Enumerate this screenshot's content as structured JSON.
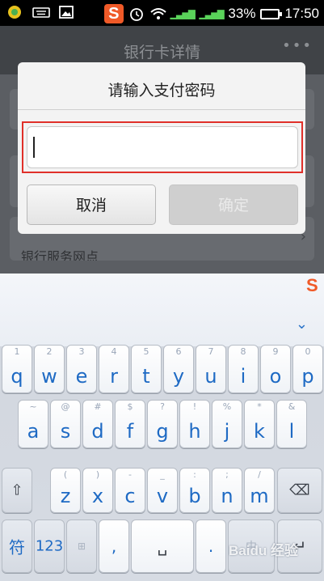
{
  "status_bar": {
    "battery": "33%",
    "time": "17:50",
    "left_icons": [
      "app-notification-icon",
      "keyboard-icon",
      "image-icon"
    ],
    "right_icons": [
      "sogou-input-icon",
      "alarm-icon",
      "wifi-icon",
      "signal-icon",
      "signal-icon",
      "battery-icon"
    ]
  },
  "background_app": {
    "title": "银行卡详情",
    "more": "•••",
    "row_label": "银行服务网点"
  },
  "dialog": {
    "title": "请输入支付密码",
    "input_value": "",
    "cancel_label": "取消",
    "confirm_label": "确定",
    "highlight_color": "#e0302a"
  },
  "keyboard": {
    "collapse_icon": "chevron-down-icon",
    "row1": [
      {
        "main": "q",
        "sub": "1"
      },
      {
        "main": "w",
        "sub": "2"
      },
      {
        "main": "e",
        "sub": "3"
      },
      {
        "main": "r",
        "sub": "4"
      },
      {
        "main": "t",
        "sub": "5"
      },
      {
        "main": "y",
        "sub": "6"
      },
      {
        "main": "u",
        "sub": "7"
      },
      {
        "main": "i",
        "sub": "8"
      },
      {
        "main": "o",
        "sub": "9"
      },
      {
        "main": "p",
        "sub": "0"
      }
    ],
    "row2": [
      {
        "main": "a",
        "sub": "~"
      },
      {
        "main": "s",
        "sub": "@"
      },
      {
        "main": "d",
        "sub": "#"
      },
      {
        "main": "f",
        "sub": "$"
      },
      {
        "main": "g",
        "sub": "?"
      },
      {
        "main": "h",
        "sub": "!"
      },
      {
        "main": "j",
        "sub": "%"
      },
      {
        "main": "k",
        "sub": "*"
      },
      {
        "main": "l",
        "sub": "&"
      }
    ],
    "row3": [
      {
        "main": "z",
        "sub": "("
      },
      {
        "main": "x",
        "sub": ")"
      },
      {
        "main": "c",
        "sub": "-"
      },
      {
        "main": "v",
        "sub": "_"
      },
      {
        "main": "b",
        "sub": ":"
      },
      {
        "main": "n",
        "sub": ";"
      },
      {
        "main": "m",
        "sub": "/"
      }
    ],
    "shift_glyph": "⇧",
    "backspace_glyph": "⌫",
    "symbol_label": "符",
    "number_label": "123",
    "comma": ",",
    "space_glyph": "␣",
    "period": ".",
    "enter_glyph": "↵"
  },
  "watermark": "Baidu 经验"
}
